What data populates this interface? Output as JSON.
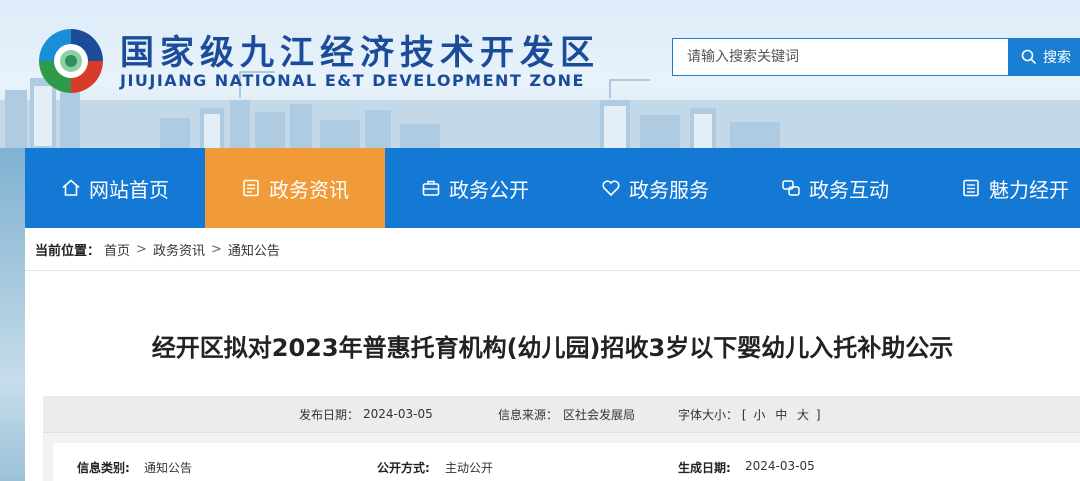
{
  "header": {
    "title": "国家级九江经济技术开发区",
    "subtitle": "JIUJIANG NATIONAL E&T DEVELOPMENT ZONE",
    "logo_icon": "circular-swirl-logo-icon"
  },
  "search": {
    "placeholder": "请输入搜索关键词",
    "button_label": "搜索",
    "icon": "search-icon"
  },
  "nav": {
    "items": [
      {
        "label": "网站首页",
        "icon": "home-icon",
        "active": false
      },
      {
        "label": "政务资讯",
        "icon": "document-icon",
        "active": true
      },
      {
        "label": "政务公开",
        "icon": "briefcase-icon",
        "active": false
      },
      {
        "label": "政务服务",
        "icon": "heart-icon",
        "active": false
      },
      {
        "label": "政务互动",
        "icon": "chat-icon",
        "active": false
      },
      {
        "label": "魅力经开",
        "icon": "list-icon",
        "active": false
      }
    ]
  },
  "breadcrumb": {
    "label": "当前位置：",
    "items": [
      "首页",
      "政务资讯",
      "通知公告"
    ],
    "separator": ">"
  },
  "article": {
    "title": "经开区拟对2023年普惠托育机构(幼儿园)招收3岁以下婴幼儿入托补助公示",
    "meta": {
      "publish_date_label": "发布日期：",
      "publish_date": "2024-03-05",
      "source_label": "信息来源：",
      "source": "区社会发展局",
      "font_size_label": "字体大小：",
      "font_size_open": "[",
      "font_size_options": [
        "小",
        "中",
        "大"
      ],
      "font_size_close": "]"
    },
    "info": {
      "category_label": "信息类别:",
      "category": "通知公告",
      "disclosure_label": "公开方式:",
      "disclosure": "主动公开",
      "created_label": "生成日期:",
      "created": "2024-03-05"
    }
  },
  "colors": {
    "nav_bg": "#1479d4",
    "nav_active": "#f19a38",
    "title_blue": "#1b4c9a",
    "search_blue": "#1a7fd2"
  }
}
